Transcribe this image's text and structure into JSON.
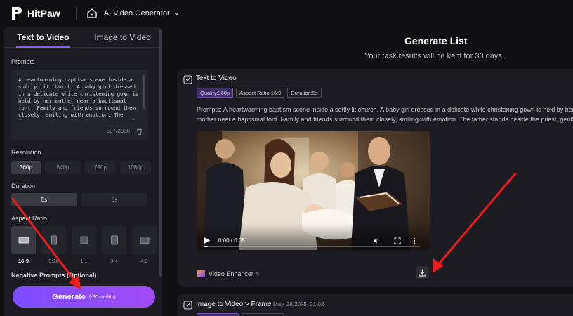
{
  "app": {
    "logo_text": "HitPaw",
    "module": "AI Video Generator"
  },
  "left_panel": {
    "tabs": [
      {
        "label": "Text to Video",
        "active": true
      },
      {
        "label": "Image to Video",
        "active": false
      }
    ],
    "prompts_label": "Prompts",
    "prompt_text": "A heartwarming baptism scene inside a softly lit church. A baby girl dressed in a delicate white christening gown is held by her mother near a baptismal font. Family and friends surround them closely, smiling with emotion. The father stands beside the priest, gently holding a small Bible, reciting a verse.",
    "prompt_count": "507/2000",
    "resolution_label": "Resolution",
    "resolutions": [
      {
        "label": "360p",
        "active": true
      },
      {
        "label": "540p",
        "active": false
      },
      {
        "label": "720p",
        "active": false
      },
      {
        "label": "1080p",
        "active": false
      }
    ],
    "duration_label": "Duration",
    "durations": [
      {
        "label": "5s",
        "active": true
      },
      {
        "label": "8s",
        "active": false
      }
    ],
    "aspect_label": "Aspect Ratio",
    "aspects": [
      {
        "label": "16:9",
        "active": true
      },
      {
        "label": "9:16",
        "active": false
      },
      {
        "label": "1:1",
        "active": false
      },
      {
        "label": "3:4",
        "active": false
      },
      {
        "label": "4:3",
        "active": false
      }
    ],
    "negative_label": "Negative Prompts (Optional)",
    "generate": {
      "label": "Generate",
      "credits": "(-30credits)"
    }
  },
  "main": {
    "title": "Generate List",
    "subtitle": "Your task results will be kept for 30 days.",
    "card": {
      "title": "Text to Video",
      "chips": [
        "Quality:360p",
        "Aspect Ratio:16:9",
        "Duration:5s"
      ],
      "prompt": "Prompts:  A heartwarming baptism scene inside a softly lit church. A baby girl dressed in a delicate white christening gown is held by her mother near a baptismal font. Family and friends surround them closely, smiling with emotion. The father stands beside the priest, gently holding a small Bible, reciting a verse.",
      "video_time": "0:00 / 0:05",
      "progress": 0.0,
      "enhancer_label": "Video Enhancer >"
    },
    "card2": {
      "title": "Image to Video > Frame",
      "date": "May, 28,2025, 21:02"
    }
  },
  "colors": {
    "accent": "#8b5cf6",
    "button_gradient_start": "#7c4dff",
    "button_gradient_end": "#a14cf6",
    "annotation_arrow": "#ee1c1c"
  },
  "icons": [
    "home-icon",
    "chevron-down-icon",
    "trash-icon",
    "play-icon",
    "volume-icon",
    "fullscreen-icon",
    "more-icon",
    "download-icon",
    "video-enhancer-icon",
    "task-icon"
  ]
}
